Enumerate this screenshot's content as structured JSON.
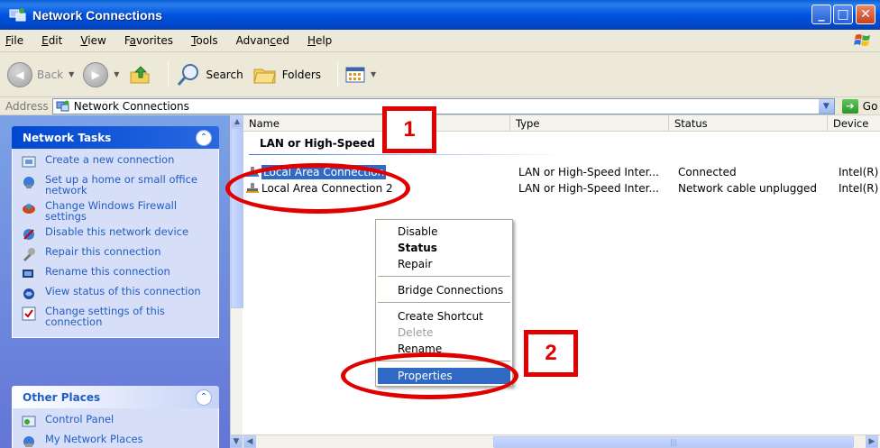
{
  "window": {
    "title": "Network Connections"
  },
  "menubar": {
    "items": [
      {
        "pre": "",
        "ul": "F",
        "post": "ile"
      },
      {
        "pre": "",
        "ul": "E",
        "post": "dit"
      },
      {
        "pre": "",
        "ul": "V",
        "post": "iew"
      },
      {
        "pre": "F",
        "ul": "a",
        "post": "vorites"
      },
      {
        "pre": "",
        "ul": "T",
        "post": "ools"
      },
      {
        "pre": "Advan",
        "ul": "c",
        "post": "ed"
      },
      {
        "pre": "",
        "ul": "H",
        "post": "elp"
      }
    ]
  },
  "toolbar": {
    "back_label": "Back",
    "search_label": "Search",
    "folders_label": "Folders"
  },
  "address": {
    "label": "Address",
    "value": "Network Connections",
    "go_label": "Go"
  },
  "left_pane": {
    "network_tasks": {
      "title": "Network Tasks",
      "items": [
        {
          "label": "Create a new connection",
          "icon": "new-connection-icon"
        },
        {
          "label": "Set up a home or small office network",
          "icon": "home-network-icon"
        },
        {
          "label": "Change Windows Firewall settings",
          "icon": "firewall-icon"
        },
        {
          "label": "Disable this network device",
          "icon": "disable-network-icon"
        },
        {
          "label": "Repair this connection",
          "icon": "repair-icon"
        },
        {
          "label": "Rename this connection",
          "icon": "rename-icon"
        },
        {
          "label": "View status of this connection",
          "icon": "status-icon"
        },
        {
          "label": "Change settings of this connection",
          "icon": "settings-icon"
        }
      ]
    },
    "other_places": {
      "title": "Other Places",
      "items": [
        {
          "label": "Control Panel",
          "icon": "control-panel-icon"
        },
        {
          "label": "My Network Places",
          "icon": "network-places-icon"
        }
      ]
    }
  },
  "list": {
    "columns": [
      "Name",
      "Type",
      "Status",
      "Device"
    ],
    "group_header": "LAN or High-Speed",
    "rows": [
      {
        "name": "Local Area Connection",
        "type": "LAN or High-Speed Inter...",
        "status": "Connected",
        "device": "Intel(R)"
      },
      {
        "name": "Local Area Connection 2",
        "type": "LAN or High-Speed Inter...",
        "status": "Network cable unplugged",
        "device": "Intel(R)"
      }
    ]
  },
  "context_menu": {
    "items": [
      "Disable",
      "Status",
      "Repair",
      "Bridge Connections",
      "Create Shortcut",
      "Delete",
      "Rename",
      "Properties"
    ]
  },
  "annotations": {
    "step1": "1",
    "step2": "2",
    "color": "#e00000"
  }
}
